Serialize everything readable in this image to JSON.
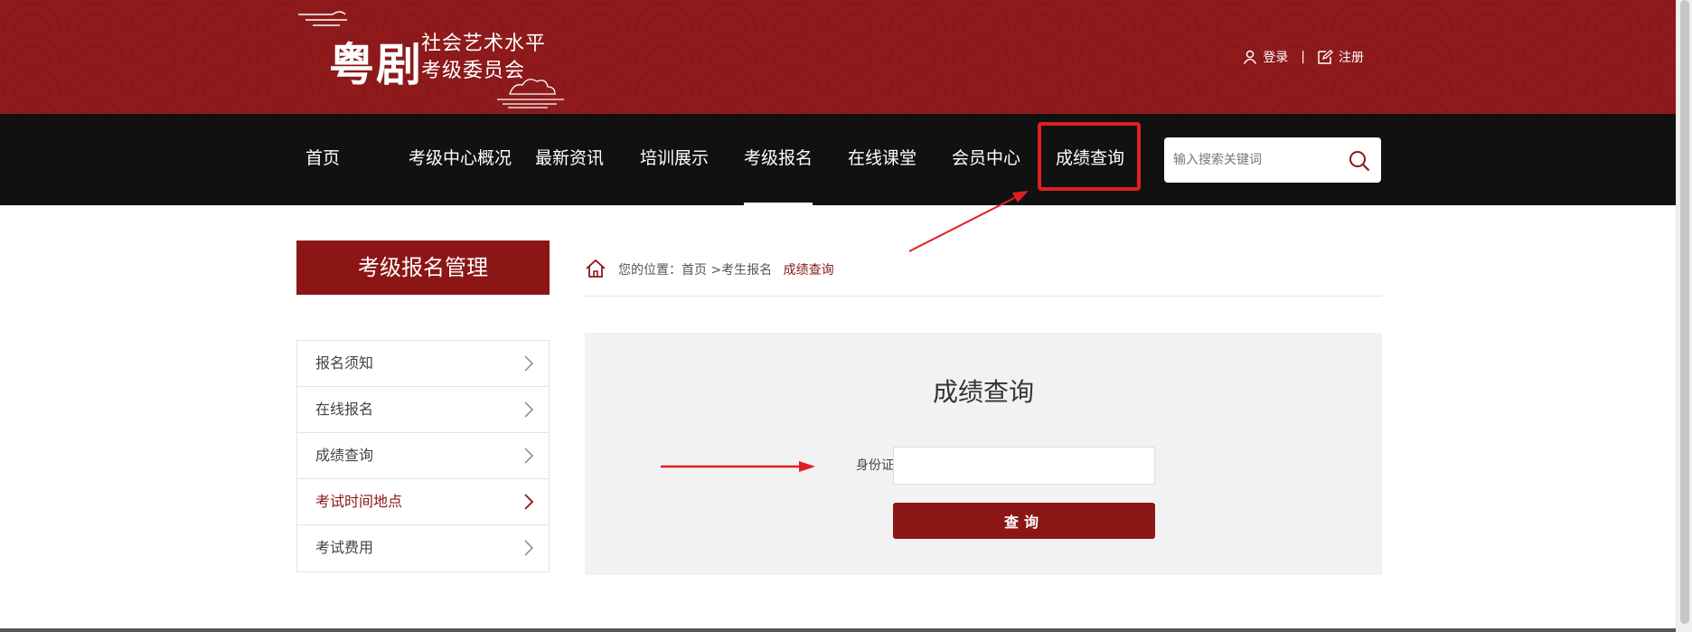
{
  "header": {
    "logo_big": "粤剧",
    "logo_line1": "社会艺术水平",
    "logo_line2": "考级委员会",
    "login_label": "登录",
    "separator": "|",
    "register_label": "注册"
  },
  "nav": {
    "items": [
      {
        "label": "首页"
      },
      {
        "label": "考级中心概况"
      },
      {
        "label": "最新资讯"
      },
      {
        "label": "培训展示"
      },
      {
        "label": "考级报名"
      },
      {
        "label": "在线课堂"
      },
      {
        "label": "会员中心"
      },
      {
        "label": "成绩查询"
      }
    ],
    "active_item": "考级报名",
    "highlighted_item": "成绩查询",
    "search_placeholder": "输入搜索关键词"
  },
  "sidebar": {
    "title": "考级报名管理",
    "items": [
      {
        "label": "报名须知"
      },
      {
        "label": "在线报名"
      },
      {
        "label": "成绩查询"
      },
      {
        "label": "考试时间地点"
      },
      {
        "label": "考试费用"
      }
    ],
    "active_item": "考试时间地点"
  },
  "breadcrumb": {
    "prefix": "您的位置：",
    "home": "首页",
    "parent": ">考生报名",
    "current": "成绩查询"
  },
  "query": {
    "title": "成绩查询",
    "id_label": "身份证号：",
    "id_value": "",
    "button_label": "查询"
  },
  "colors": {
    "brand_red": "#8c1616",
    "header_red": "#8e1a1c",
    "nav_black": "#111111",
    "annotation_red": "#e02020",
    "panel_gray": "#f2f2f2"
  }
}
